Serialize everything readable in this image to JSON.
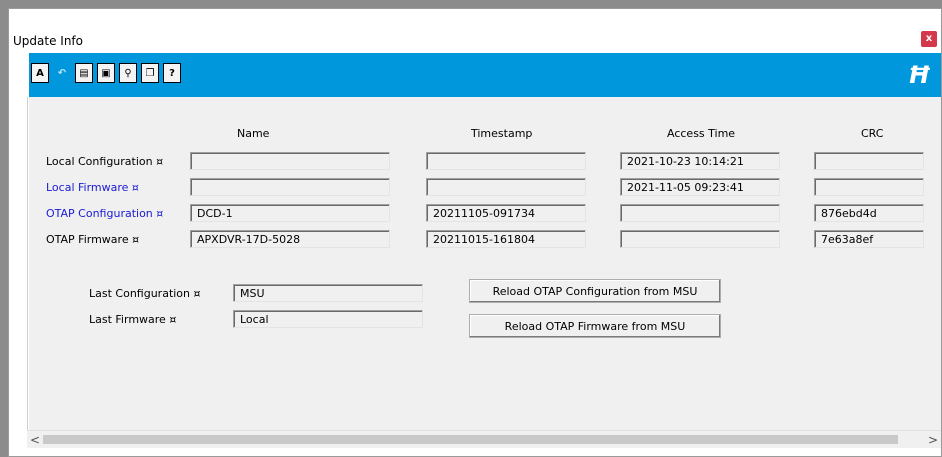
{
  "window": {
    "title": "Update Info",
    "close_label": "x"
  },
  "toolbar": {
    "buttons": [
      {
        "name": "spellcheck-icon",
        "glyph": "A"
      },
      {
        "name": "undo-icon",
        "glyph": "↶"
      },
      {
        "name": "copy-icon",
        "glyph": "▤"
      },
      {
        "name": "paste-icon",
        "glyph": "▣"
      },
      {
        "name": "find-icon",
        "glyph": "⚲"
      },
      {
        "name": "window-icon",
        "glyph": "❐"
      },
      {
        "name": "help-icon",
        "glyph": "?"
      }
    ],
    "logo_glyph": "Ħ"
  },
  "columns": {
    "name": "Name",
    "timestamp": "Timestamp",
    "access_time": "Access Time",
    "crc": "CRC"
  },
  "rows": [
    {
      "label": "Local Configuration ¤",
      "name": "",
      "timestamp": "",
      "access_time": "2021-10-23 10:14:21",
      "crc": ""
    },
    {
      "label": "Local Firmware ¤",
      "name": "",
      "timestamp": "",
      "access_time": "2021-11-05 09:23:41",
      "crc": ""
    },
    {
      "label": "OTAP Configuration ¤",
      "name": "DCD-1",
      "timestamp": "20211105-091734",
      "access_time": "",
      "crc": "876ebd4d"
    },
    {
      "label": "OTAP Firmware ¤",
      "name": "APXDVR-17D-5028",
      "timestamp": "20211015-161804",
      "access_time": "",
      "crc": "7e63a8ef"
    }
  ],
  "last": {
    "configuration_label": "Last Configuration ¤",
    "configuration_value": "MSU",
    "firmware_label": "Last Firmware ¤",
    "firmware_value": "Local"
  },
  "buttons": {
    "reload_config": "Reload OTAP Configuration from MSU",
    "reload_firmware": "Reload OTAP Firmware from MSU"
  },
  "scrollbar": {
    "left_arrow": "<",
    "right_arrow": ">"
  }
}
